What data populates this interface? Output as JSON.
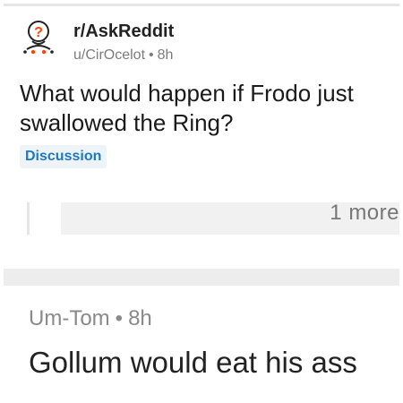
{
  "post": {
    "subreddit": "r/AskReddit",
    "author": "u/CirOcelot",
    "age": "8h",
    "separator": "•",
    "title": "What would happen if Frodo just swallowed the Ring?",
    "flair": "Discussion",
    "icon": "askreddit-snoo-icon"
  },
  "thread": {
    "more_label": "1 more"
  },
  "comment": {
    "author": "Um-Tom",
    "age": "8h",
    "separator": "•",
    "body": "Gollum would eat his ass"
  },
  "colors": {
    "flair_text": "#1e78c2",
    "flair_bg": "#eef3f7",
    "muted_text": "#7c7c7c",
    "divider": "#ededed"
  }
}
